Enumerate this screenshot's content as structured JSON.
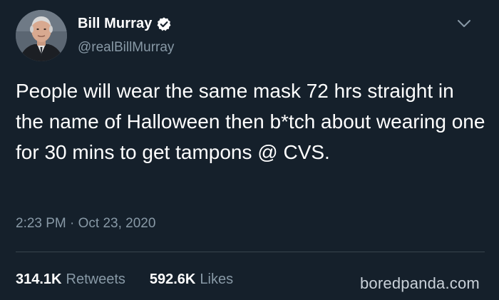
{
  "user": {
    "display_name": "Bill Murray",
    "handle": "@realBillMurray",
    "verified": true,
    "verified_icon": "verified-badge-icon"
  },
  "tweet": {
    "text": "People will wear the same mask 72 hrs straight in the name of Halloween then b*tch about wearing one for 30 mins to get tampons @ CVS.",
    "timestamp": "2:23 PM · Oct 23, 2020"
  },
  "stats": {
    "retweets_count": "314.1K",
    "retweets_label": "Retweets",
    "likes_count": "592.6K",
    "likes_label": "Likes"
  },
  "watermark": "boredpanda.com",
  "colors": {
    "background": "#15202b",
    "text": "#ffffff",
    "secondary_text": "#8899a6",
    "divider": "#38444d",
    "verified": "#ffffff"
  }
}
